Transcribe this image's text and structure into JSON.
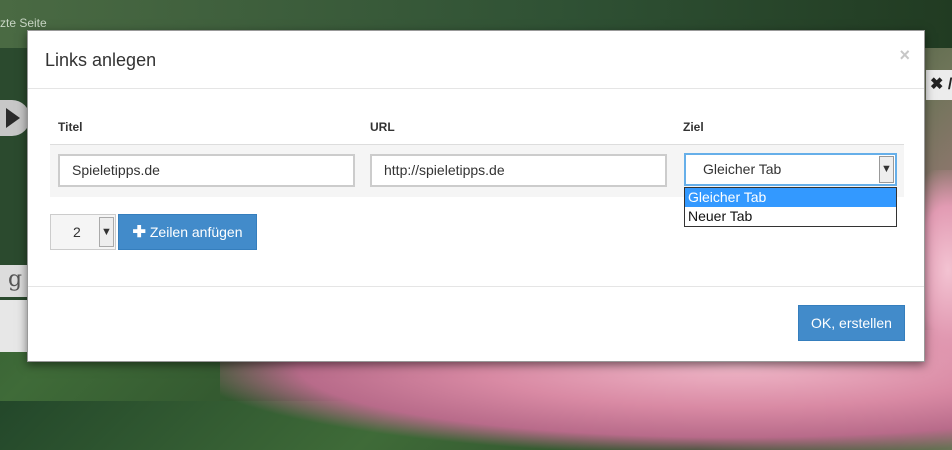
{
  "background": {
    "page_text": "zte Seite",
    "g_icon_char": "g",
    "close_partial": "✖ /"
  },
  "modal": {
    "title": "Links anlegen",
    "close_label": "×",
    "columns": [
      "Titel",
      "URL",
      "Ziel"
    ],
    "row": {
      "title_value": "Spieletipps.de",
      "url_value": "http://spieletipps.de",
      "target_value": "Gleicher Tab"
    },
    "target_options": [
      "Gleicher Tab",
      "Neuer Tab"
    ],
    "target_selected_index": 0,
    "row_count_value": "2",
    "add_rows_label": "Zeilen anfügen",
    "ok_label": "OK, erstellen"
  },
  "colors": {
    "primary": "#428bca",
    "dropdown_highlight": "#3399ff",
    "focus_border": "#66afe9"
  },
  "icons": {
    "close": "close-icon",
    "dropdown": "chevron-down-icon",
    "add": "plus-icon"
  }
}
